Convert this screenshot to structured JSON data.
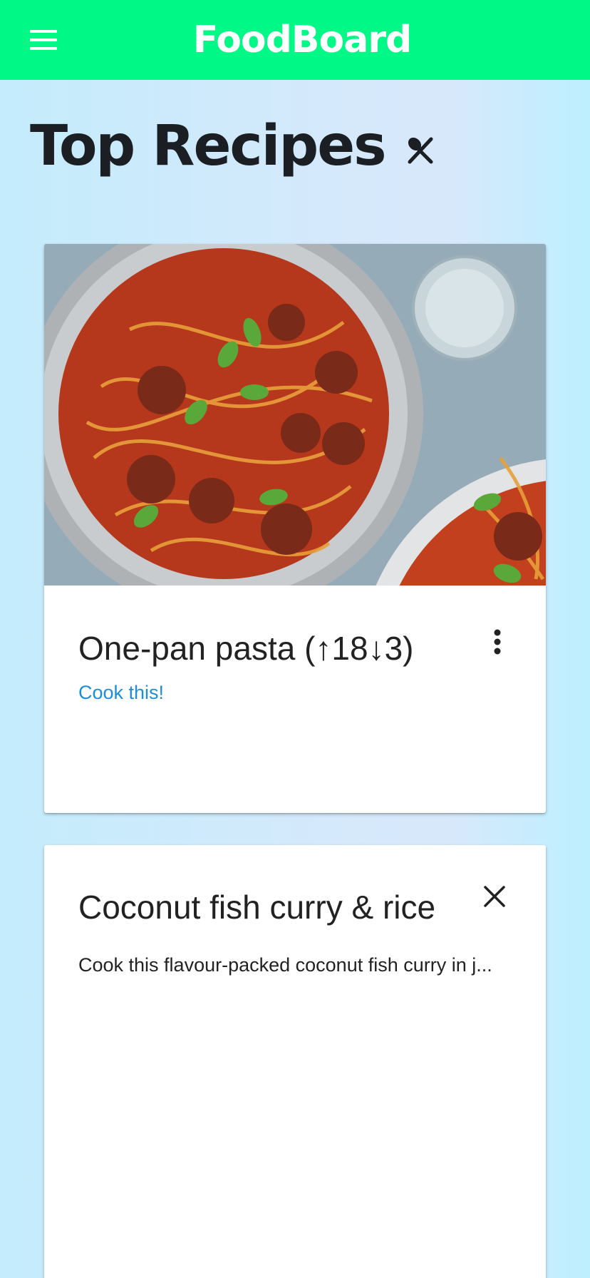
{
  "app": {
    "title": "FoodBoard",
    "accent_color": "#00f986",
    "menu_icon": "hamburger-menu-icon"
  },
  "page": {
    "heading": "Top Recipes",
    "heading_icon": "fork-knife-icon"
  },
  "recipes": [
    {
      "title": "One-pan pasta (↑18↓3)",
      "image": "spaghetti-meatballs-photo",
      "action_label": "Cook this!",
      "menu_icon": "more-vert-icon"
    },
    {
      "title": "Coconut fish curry & rice",
      "description": "Cook this flavour-packed coconut fish curry in j...",
      "close_icon": "close-icon"
    }
  ]
}
